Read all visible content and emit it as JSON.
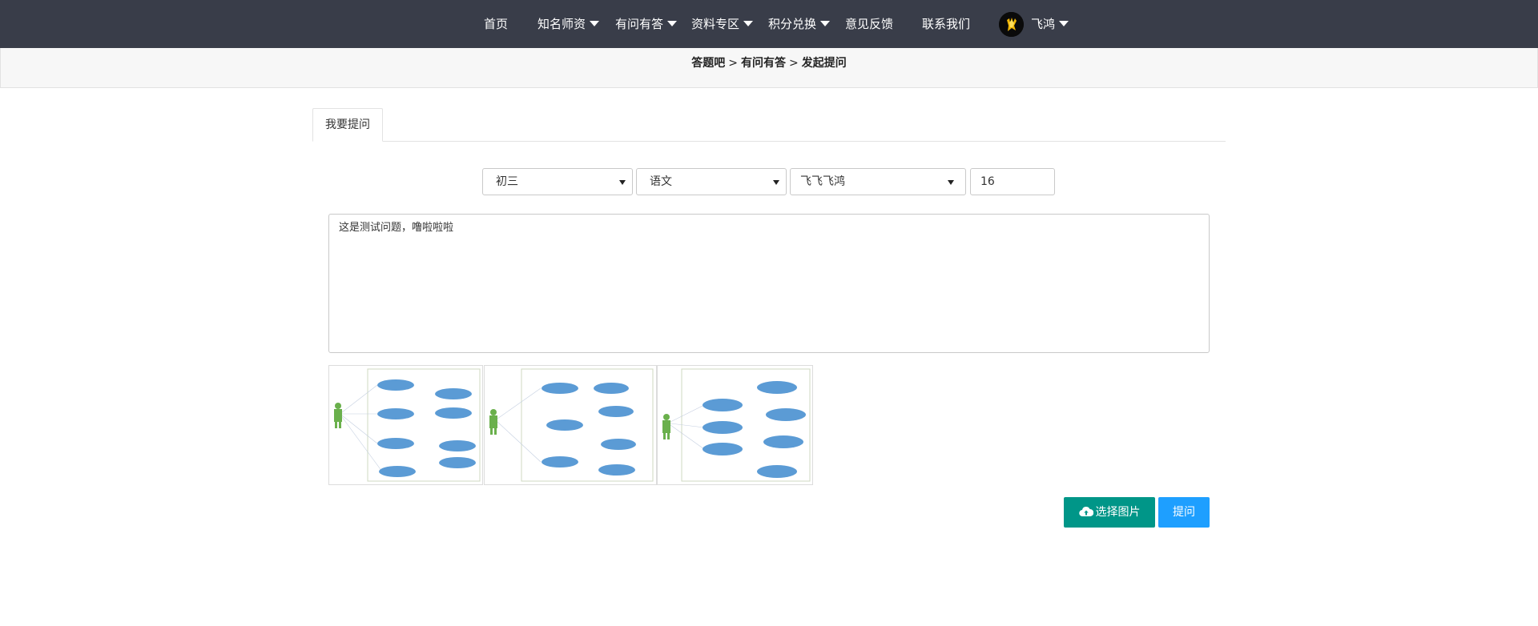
{
  "nav": {
    "items": [
      {
        "label": "首页",
        "dropdown": false
      },
      {
        "label": "知名师资",
        "dropdown": true
      },
      {
        "label": "有问有答",
        "dropdown": true
      },
      {
        "label": "资料专区",
        "dropdown": true
      },
      {
        "label": "积分兑换",
        "dropdown": true
      },
      {
        "label": "意见反馈",
        "dropdown": false
      },
      {
        "label": "联系我们",
        "dropdown": false
      }
    ],
    "user": {
      "name": "飞鸿",
      "dropdown": true
    },
    "bg_color": "#393d49"
  },
  "breadcrumb": {
    "items": [
      "答题吧",
      "有问有答",
      "发起提问"
    ],
    "separator": ">"
  },
  "tabs": [
    {
      "label": "我要提问",
      "active": true
    }
  ],
  "form": {
    "grade": {
      "selected": "初三"
    },
    "subject": {
      "selected": "语文"
    },
    "teacher": {
      "selected": "飞飞飞鸿"
    },
    "points": {
      "value": "16"
    },
    "question": {
      "value": "这是测试问题，噜啦啦啦"
    }
  },
  "attachments": {
    "count": 3,
    "kind": "use-case-diagram-thumbnail"
  },
  "buttons": {
    "upload_label": "选择图片",
    "upload_color": "#009688",
    "submit_label": "提问",
    "submit_color": "#1e9fff"
  }
}
